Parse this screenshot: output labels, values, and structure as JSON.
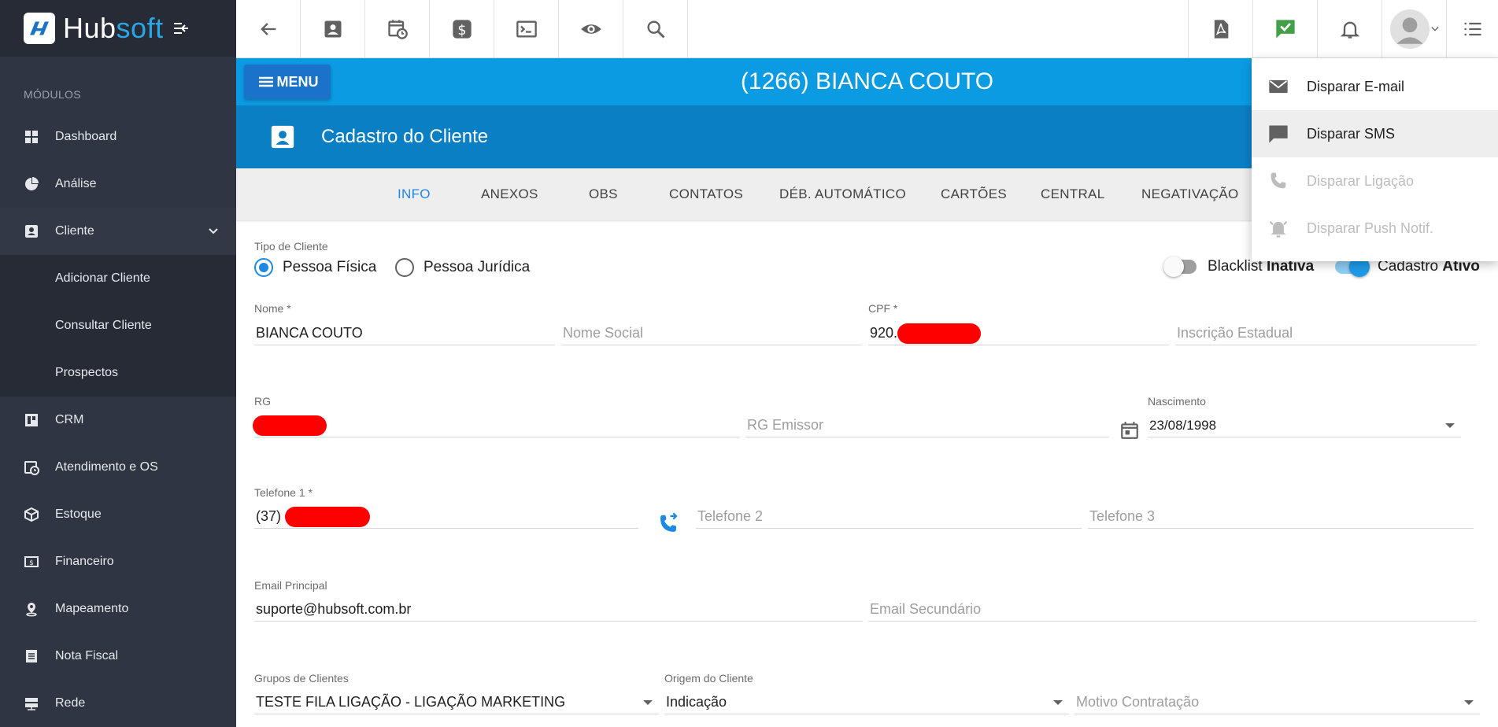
{
  "sidebar": {
    "logo_hub": "Hub",
    "logo_soft": "soft",
    "modules_title": "MÓDULOS",
    "items": [
      {
        "label": "Dashboard"
      },
      {
        "label": "Análise"
      },
      {
        "label": "Cliente"
      },
      {
        "label": "CRM"
      },
      {
        "label": "Atendimento e OS"
      },
      {
        "label": "Estoque"
      },
      {
        "label": "Financeiro"
      },
      {
        "label": "Mapeamento"
      },
      {
        "label": "Nota Fiscal"
      },
      {
        "label": "Rede"
      }
    ],
    "cliente_sub": [
      {
        "label": "Adicionar Cliente"
      },
      {
        "label": "Consultar Cliente"
      },
      {
        "label": "Prospectos"
      }
    ]
  },
  "header": {
    "menu_label": "MENU",
    "client_title": "(1266) BIANCA COUTO",
    "section_title": "Cadastro do Cliente"
  },
  "tabs": [
    {
      "label": "INFO"
    },
    {
      "label": "ANEXOS"
    },
    {
      "label": "OBS"
    },
    {
      "label": "CONTATOS"
    },
    {
      "label": "DÉB. AUTOMÁTICO"
    },
    {
      "label": "CARTÕES"
    },
    {
      "label": "CENTRAL"
    },
    {
      "label": "NEGATIVAÇÃO"
    }
  ],
  "form": {
    "tipo_label": "Tipo de Cliente",
    "pf_label": "Pessoa Física",
    "pj_label": "Pessoa Jurídica",
    "blacklist_label": "Blacklist",
    "blacklist_state": "Inativa",
    "cadastro_label": "Cadastro",
    "cadastro_state": "Ativo",
    "nome_label": "Nome *",
    "nome_value": "BIANCA COUTO",
    "nome_social_ph": "Nome Social",
    "cpf_label": "CPF *",
    "cpf_prefix": "920.",
    "insc_ph": "Inscrição Estadual",
    "rg_label": "RG",
    "rg_emissor_ph": "RG Emissor",
    "nasc_label": "Nascimento",
    "nasc_value": "23/08/1998",
    "tel1_label": "Telefone 1 *",
    "tel1_prefix": "(37)",
    "tel2_ph": "Telefone 2",
    "tel3_ph": "Telefone 3",
    "email_label": "Email Principal",
    "email_value": "suporte@hubsoft.com.br",
    "email2_ph": "Email Secundário",
    "grupos_label": "Grupos de Clientes",
    "grupos_value": "TESTE FILA LIGAÇÃO - LIGAÇÃO MARKETING",
    "origem_label": "Origem do Cliente",
    "origem_value": "Indicação",
    "motivo_ph": "Motivo Contratação"
  },
  "dropdown": {
    "items": [
      {
        "label": "Disparar E-mail"
      },
      {
        "label": "Disparar SMS"
      },
      {
        "label": "Disparar Ligação"
      },
      {
        "label": "Disparar Push Notif."
      }
    ]
  },
  "colors": {
    "sidebar_bg": "#2f3542",
    "client_bar": "#0b9be3",
    "section_bar": "#0a7fc4",
    "accent": "#1e88e5",
    "redaction": "#ff0000",
    "check_green": "#43a047"
  }
}
